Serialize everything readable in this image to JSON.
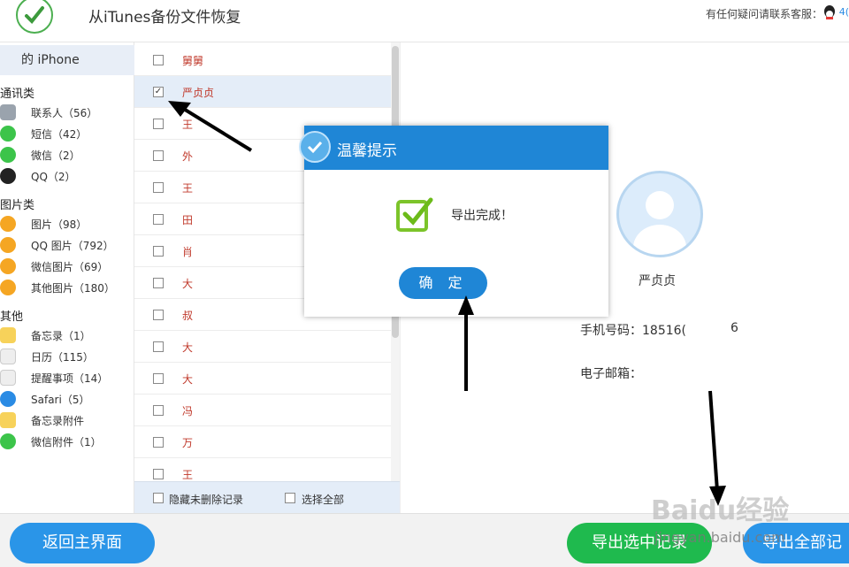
{
  "header": {
    "title": "从iTunes备份文件恢复",
    "support_text": "有任何疑问请联系客服：",
    "qq_number": "4("
  },
  "sidebar": {
    "device": "的 iPhone",
    "categories": [
      {
        "label": "通讯类",
        "items": [
          {
            "label": "联系人（56）",
            "icon": "contacts-icon",
            "color": "#9aa3ad"
          },
          {
            "label": "短信（42）",
            "icon": "sms-icon",
            "color": "#3cc44a"
          },
          {
            "label": "微信（2）",
            "icon": "wechat-icon",
            "color": "#3cc44a"
          },
          {
            "label": "QQ（2）",
            "icon": "qq-icon",
            "color": "#222222"
          }
        ]
      },
      {
        "label": "图片类",
        "items": [
          {
            "label": "图片（98）",
            "icon": "photos-icon",
            "color": "#f5a623"
          },
          {
            "label": "QQ 图片（792）",
            "icon": "qq-photos-icon",
            "color": "#f5a623"
          },
          {
            "label": "微信图片（69）",
            "icon": "wechat-photos-icon",
            "color": "#f5a623"
          },
          {
            "label": "其他图片（180）",
            "icon": "other-photos-icon",
            "color": "#f5a623"
          }
        ]
      },
      {
        "label": "其他",
        "items": [
          {
            "label": "备忘录（1）",
            "icon": "notes-icon",
            "color": "#f7d25a"
          },
          {
            "label": "日历（115）",
            "icon": "calendar-icon",
            "color": "#e8e8e8"
          },
          {
            "label": "提醒事项（14）",
            "icon": "reminders-icon",
            "color": "#e8e8e8"
          },
          {
            "label": "Safari（5）",
            "icon": "safari-icon",
            "color": "#2a8be4"
          },
          {
            "label": "备忘录附件",
            "icon": "notes-attachment-icon",
            "color": "#f7d25a"
          },
          {
            "label": "微信附件（1）",
            "icon": "wechat-attachment-icon",
            "color": "#3cc44a"
          }
        ]
      }
    ]
  },
  "contacts": {
    "rows": [
      {
        "name": "舅舅",
        "checked": false
      },
      {
        "name": "严贞贞",
        "checked": true
      },
      {
        "name": "王",
        "checked": false
      },
      {
        "name": "外",
        "checked": false
      },
      {
        "name": "王",
        "checked": false
      },
      {
        "name": "田",
        "checked": false
      },
      {
        "name": "肖",
        "checked": false
      },
      {
        "name": "大",
        "checked": false
      },
      {
        "name": "叔",
        "checked": false
      },
      {
        "name": "大",
        "checked": false
      },
      {
        "name": "大",
        "checked": false
      },
      {
        "name": "冯",
        "checked": false
      },
      {
        "name": "万",
        "checked": false
      },
      {
        "name": "王",
        "checked": false
      }
    ],
    "footer": {
      "hide_undeleted": "隐藏未删除记录",
      "select_all": "选择全部"
    }
  },
  "detail": {
    "name": "严贞贞",
    "phone_label": "手机号码：18516(",
    "phone_tail": "6",
    "email_label": "电子邮箱："
  },
  "dialog": {
    "title": "温馨提示",
    "message": "导出完成！",
    "ok_label": "确 定"
  },
  "bottom": {
    "back_label": "返回主界面",
    "export_selected_label": "导出选中记录",
    "export_all_label": "导出全部记"
  },
  "watermark": {
    "text": "Baidu经验",
    "url": "jingyan.baidu.com"
  }
}
